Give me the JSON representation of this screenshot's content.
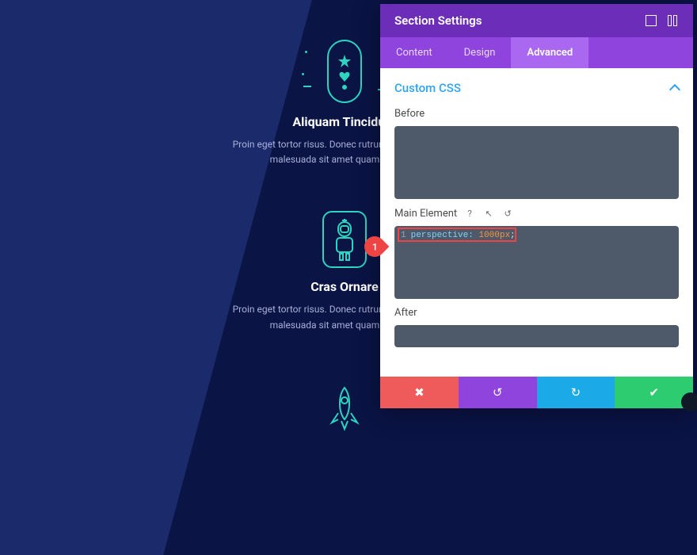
{
  "panel": {
    "title": "Section Settings",
    "tabs": {
      "content": "Content",
      "design": "Design",
      "advanced": "Advanced"
    },
    "accordion": "Custom CSS",
    "fields": {
      "before": "Before",
      "main": "Main Element",
      "after": "After"
    },
    "code": {
      "main_line": "1",
      "main_prop": "perspective:",
      "main_val": "1000px",
      "main_semi": ";"
    }
  },
  "callout": {
    "num": "1"
  },
  "content": {
    "block1": {
      "heading": "Aliquam Tincidunt",
      "para": "Proin eget tortor risus. Donec rutrum congue leo eget malesuada sit amet quam vehicula."
    },
    "block2": {
      "heading": "Cras Ornare",
      "para": "Proin eget tortor risus. Donec rutrum congue leo eget malesuada sit amet quam vehicula."
    }
  }
}
